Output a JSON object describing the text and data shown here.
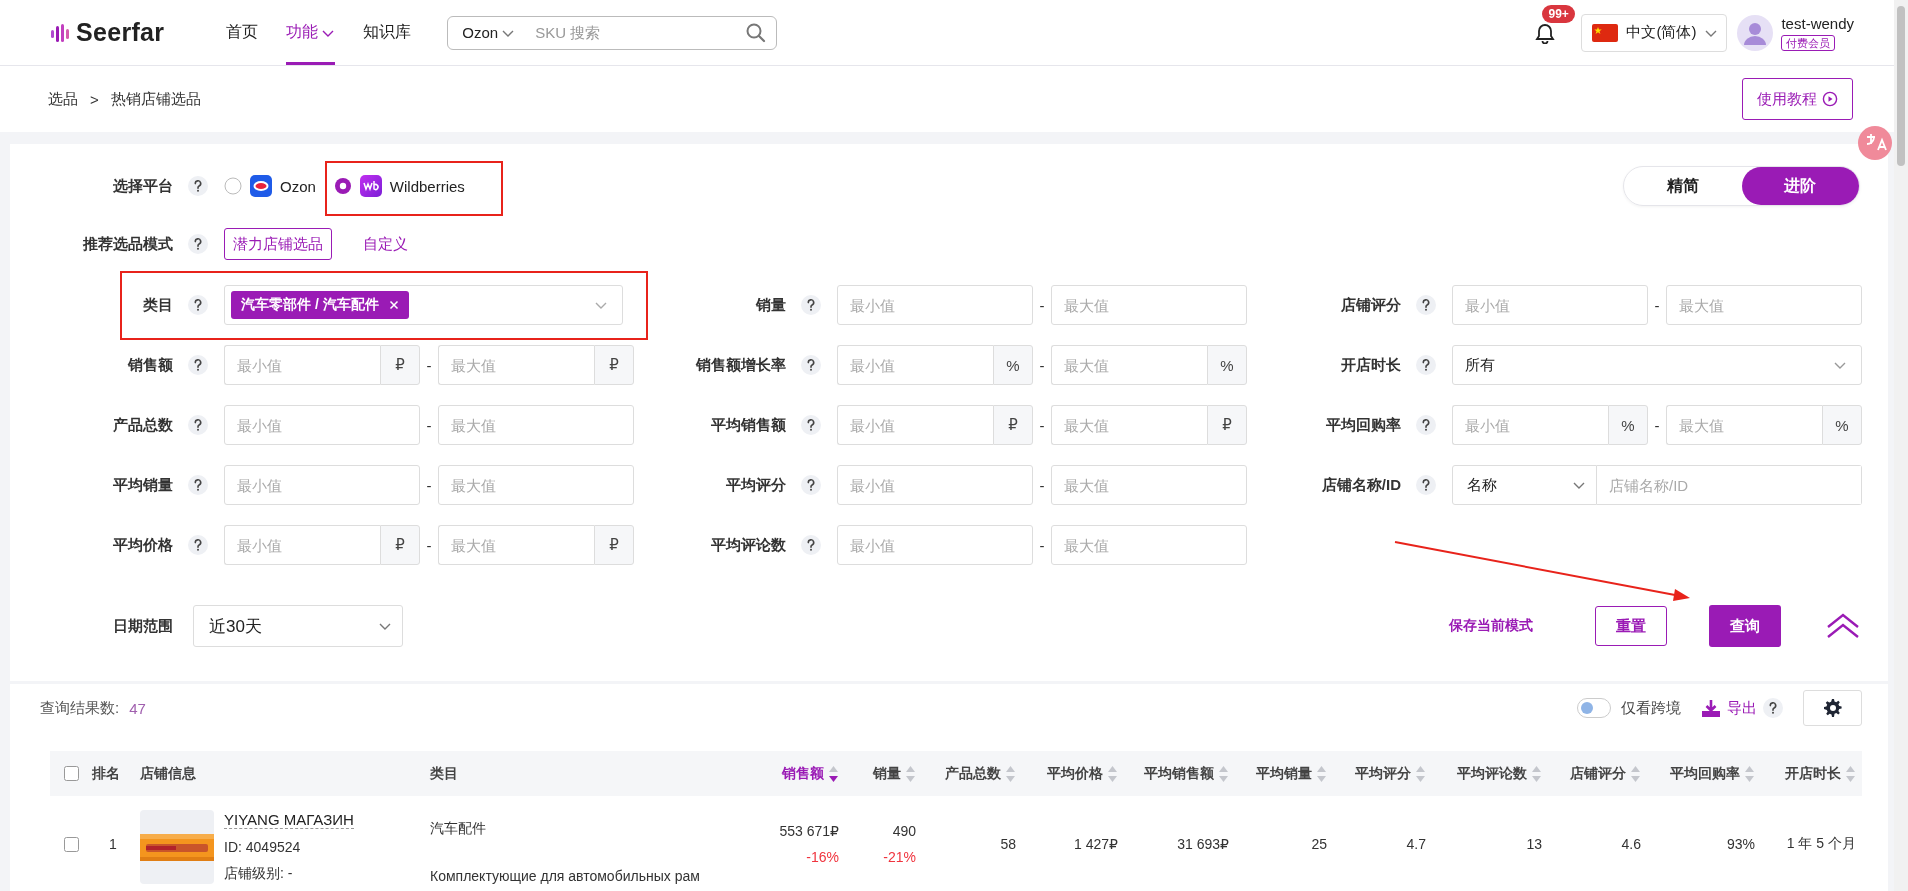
{
  "header": {
    "logo": "Seerfar",
    "nav": [
      {
        "label": "首页",
        "selected": false,
        "dropdown": false
      },
      {
        "label": "功能",
        "selected": true,
        "dropdown": true
      },
      {
        "label": "知识库",
        "selected": false,
        "dropdown": false
      }
    ],
    "search": {
      "platform": "Ozon",
      "placeholder": "SKU 搜索"
    },
    "notifications": {
      "badge": "99+"
    },
    "language": "中文(简体)",
    "user": {
      "name": "test-wendy",
      "tag": "付费会员"
    }
  },
  "breadcrumb": {
    "items": [
      "选品",
      "热销店铺选品"
    ],
    "separator": ">"
  },
  "tutorial_button": "使用教程",
  "filters": {
    "platform": {
      "label": "选择平台",
      "options": [
        {
          "label": "Ozon",
          "selected": false
        },
        {
          "label": "Wildberries",
          "selected": true
        }
      ]
    },
    "view_toggle": [
      {
        "label": "精简",
        "selected": false
      },
      {
        "label": "进阶",
        "selected": true
      }
    ],
    "mode": {
      "label": "推荐选品模式",
      "options": [
        {
          "label": "潜力店铺选品",
          "selected": true
        },
        {
          "label": "自定义",
          "selected": false
        }
      ]
    },
    "fields": [
      {
        "kind": "tags",
        "label": "类目",
        "tags": [
          "汽车零部件 / 汽车配件"
        ]
      },
      {
        "kind": "range",
        "label": "销量",
        "min_placeholder": "最小值",
        "max_placeholder": "最大值",
        "separator": "-"
      },
      {
        "kind": "range",
        "label": "店铺评分",
        "min_placeholder": "最小值",
        "max_placeholder": "最大值",
        "separator": "-"
      },
      {
        "kind": "range",
        "label": "销售额",
        "min_placeholder": "最小值",
        "max_placeholder": "最大值",
        "separator": "-",
        "unit": "₽"
      },
      {
        "kind": "range",
        "label": "销售额增长率",
        "min_placeholder": "最小值",
        "max_placeholder": "最大值",
        "separator": "-",
        "unit": "%"
      },
      {
        "kind": "select",
        "label": "开店时长",
        "value": "所有"
      },
      {
        "kind": "range",
        "label": "产品总数",
        "min_placeholder": "最小值",
        "max_placeholder": "最大值",
        "separator": "-"
      },
      {
        "kind": "range",
        "label": "平均销售额",
        "min_placeholder": "最小值",
        "max_placeholder": "最大值",
        "separator": "-",
        "unit": "₽"
      },
      {
        "kind": "range",
        "label": "平均回购率",
        "min_placeholder": "最小值",
        "max_placeholder": "最大值",
        "separator": "-",
        "unit": "%"
      },
      {
        "kind": "range",
        "label": "平均销量",
        "min_placeholder": "最小值",
        "max_placeholder": "最大值",
        "separator": "-"
      },
      {
        "kind": "range",
        "label": "平均评分",
        "min_placeholder": "最小值",
        "max_placeholder": "最大值",
        "separator": "-"
      },
      {
        "kind": "combo",
        "label": "店铺名称/ID",
        "value": "名称",
        "placeholder": "店铺名称/ID"
      },
      {
        "kind": "range",
        "label": "平均价格",
        "min_placeholder": "最小值",
        "max_placeholder": "最大值",
        "separator": "-",
        "unit": "₽"
      },
      {
        "kind": "range",
        "label": "平均评论数",
        "min_placeholder": "最小值",
        "max_placeholder": "最大值",
        "separator": "-"
      }
    ],
    "date": {
      "label": "日期范围",
      "value": "近30天"
    },
    "save_link": "保存当前模式",
    "reset_button": "重置",
    "query_button": "查询"
  },
  "results": {
    "label": "查询结果数:",
    "count": "47",
    "cross_border": {
      "label": "仅看跨境",
      "on": false
    },
    "export": "导出"
  },
  "table": {
    "select_all": false,
    "columns": [
      {
        "label": "排名"
      },
      {
        "label": "店铺信息"
      },
      {
        "label": "类目"
      },
      {
        "label": "销售额",
        "sorted": true
      },
      {
        "label": "销量",
        "sorted": false
      },
      {
        "label": "产品总数",
        "sorted": false
      },
      {
        "label": "平均价格",
        "sorted": false
      },
      {
        "label": "平均销售额",
        "sorted": false
      },
      {
        "label": "平均销量",
        "sorted": false
      },
      {
        "label": "平均评分",
        "sorted": false
      },
      {
        "label": "平均评论数",
        "sorted": false
      },
      {
        "label": "店铺评分",
        "sorted": false
      },
      {
        "label": "平均回购率",
        "sorted": false
      },
      {
        "label": "开店时长",
        "sorted": false
      }
    ],
    "rows": [
      {
        "selected": false,
        "rank": "1",
        "store": {
          "name": "YIYANG МАГАЗИН",
          "id": "ID: 4049524",
          "level": "店铺级别: -"
        },
        "category": [
          "汽车配件",
          "Комплектующие для автомобильных рам"
        ],
        "sales": {
          "value": "553 671₽",
          "change": "-16%",
          "negative": true
        },
        "qty": {
          "value": "490",
          "change": "-21%",
          "negative": true
        },
        "metrics": [
          "58",
          "1 427₽",
          "31 693₽",
          "25",
          "4.7",
          "13",
          "4.6",
          "93%",
          "1 年 5 个月"
        ]
      }
    ]
  }
}
